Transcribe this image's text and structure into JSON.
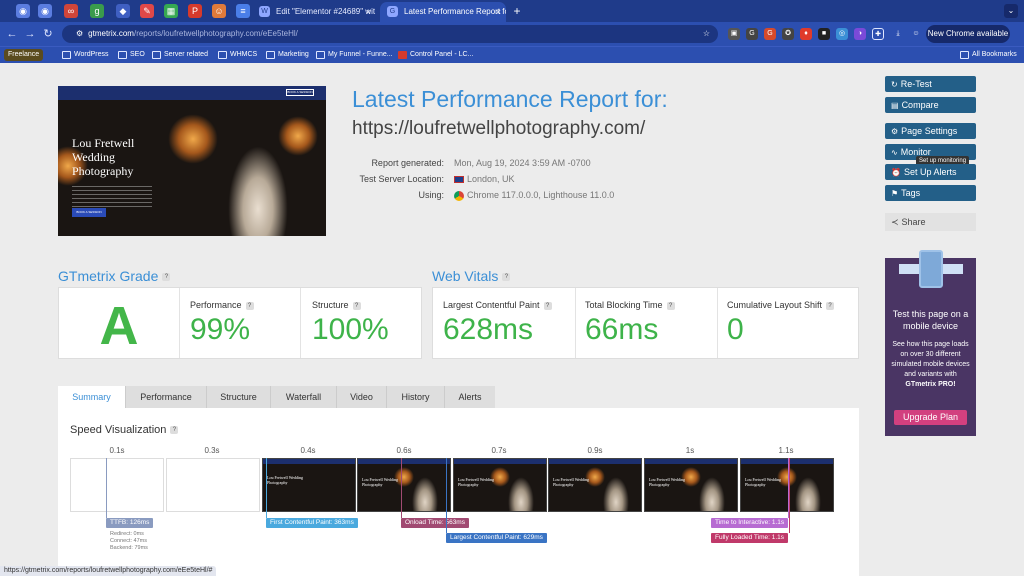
{
  "browser": {
    "tabs": [
      {
        "title": "Edit \"Elementor #24689\" wit"
      },
      {
        "title": "Latest Performance Report fo"
      }
    ],
    "url_host": "gtmetrix.com",
    "url_path": "/reports/loufretwellphotography.com/eEe5teHl/",
    "new_chrome": "New Chrome available",
    "bookmarks": [
      "WordPress",
      "SEO",
      "Server related",
      "WHMCS",
      "Marketing",
      "My Funnel - Funne...",
      "Control Panel - LC..."
    ],
    "freelance": "Freelance",
    "all_bookmarks": "All Bookmarks",
    "status_url": "https://gtmetrix.com/reports/loufretwellphotography.com/eEe5teHl/#"
  },
  "screenshot": {
    "site_title": "Lou Fretwell Wedding Photography",
    "book_label": "BOOK A SESSION"
  },
  "report": {
    "title": "Latest Performance Report for:",
    "url": "https://loufretwellphotography.com/",
    "generated_label": "Report generated:",
    "generated_value": "Mon, Aug 19, 2024 3:59 AM -0700",
    "server_label": "Test Server Location:",
    "server_value": "London, UK",
    "using_label": "Using:",
    "using_value": "Chrome 117.0.0.0, Lighthouse 11.0.0"
  },
  "grade": {
    "title": "GTmetrix Grade",
    "letter": "A",
    "performance_label": "Performance",
    "performance_value": "99%",
    "structure_label": "Structure",
    "structure_value": "100%"
  },
  "vitals": {
    "title": "Web Vitals",
    "lcp_label": "Largest Contentful Paint",
    "lcp_value": "628ms",
    "tbt_label": "Total Blocking Time",
    "tbt_value": "66ms",
    "cls_label": "Cumulative Layout Shift",
    "cls_value": "0"
  },
  "actions": {
    "retest": "Re-Test",
    "compare": "Compare",
    "page_settings": "Page Settings",
    "monitor": "Monitor",
    "monitor_tooltip": "Set up monitoring",
    "alerts": "Set Up Alerts",
    "tags": "Tags",
    "share": "Share"
  },
  "promo": {
    "title": "Test this page on a mobile device",
    "desc_pre": "See how this page loads on over 30 different simulated mobile devices and variants with",
    "desc_brand": "GTmetrix PRO!",
    "button": "Upgrade Plan"
  },
  "tabs": [
    "Summary",
    "Performance",
    "Structure",
    "Waterfall",
    "Video",
    "History",
    "Alerts"
  ],
  "speed": {
    "title": "Speed Visualization",
    "ticks": [
      "0.1s",
      "0.3s",
      "0.4s",
      "0.6s",
      "0.7s",
      "0.9s",
      "1s",
      "1.1s"
    ],
    "ttfb": "TTFB: 126ms",
    "ttfb_details": [
      "Redirect: 0ms",
      "Connect: 47ms",
      "Backend: 79ms"
    ],
    "fcp": "First Contentful Paint: 363ms",
    "onload": "Onload Time: 563ms",
    "lcp": "Largest Contentful Paint: 629ms",
    "tti": "Time to Interactive: 1.1s",
    "fully": "Fully Loaded Time: 1.1s"
  },
  "colors": {
    "ttfb": "#8a9bc0",
    "fcp": "#4aa9de",
    "onload": "#a14a72",
    "lcp": "#3a74c4",
    "tti": "#b76bd2",
    "fully": "#c0396a"
  }
}
